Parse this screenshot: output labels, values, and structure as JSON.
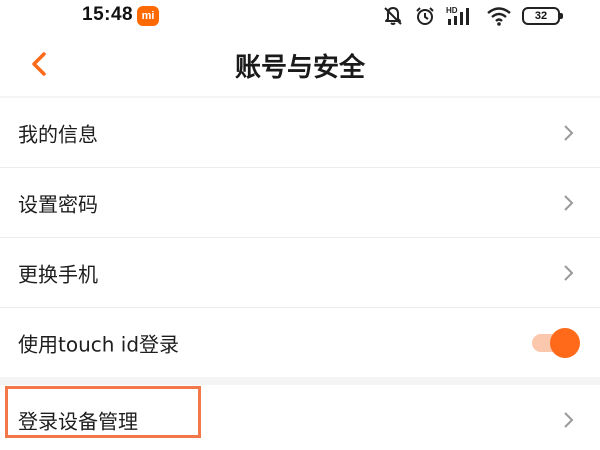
{
  "status_bar": {
    "time": "15:48",
    "brand_badge": "mi",
    "battery_level": "32",
    "icons": [
      "bell-off-icon",
      "alarm-icon",
      "hd-signal-icon",
      "wifi-icon",
      "battery-icon"
    ]
  },
  "header": {
    "title": "账号与安全",
    "back_icon": "chevron-left-icon"
  },
  "settings": {
    "items": [
      {
        "label": "我的信息",
        "control": "chevron-right-icon"
      },
      {
        "label": "设置密码",
        "control": "chevron-right-icon"
      },
      {
        "label": "更换手机",
        "control": "chevron-right-icon"
      },
      {
        "label": "使用touch id登录",
        "control": "toggle",
        "toggle_on": true
      },
      {
        "label": "登录设备管理",
        "control": "chevron-right-icon",
        "highlighted": true
      }
    ]
  },
  "colors": {
    "accent": "#ff6a1a",
    "toggle_track": "#fbc7ad",
    "highlight_border": "#f27849",
    "background": "#f4f4f4"
  }
}
